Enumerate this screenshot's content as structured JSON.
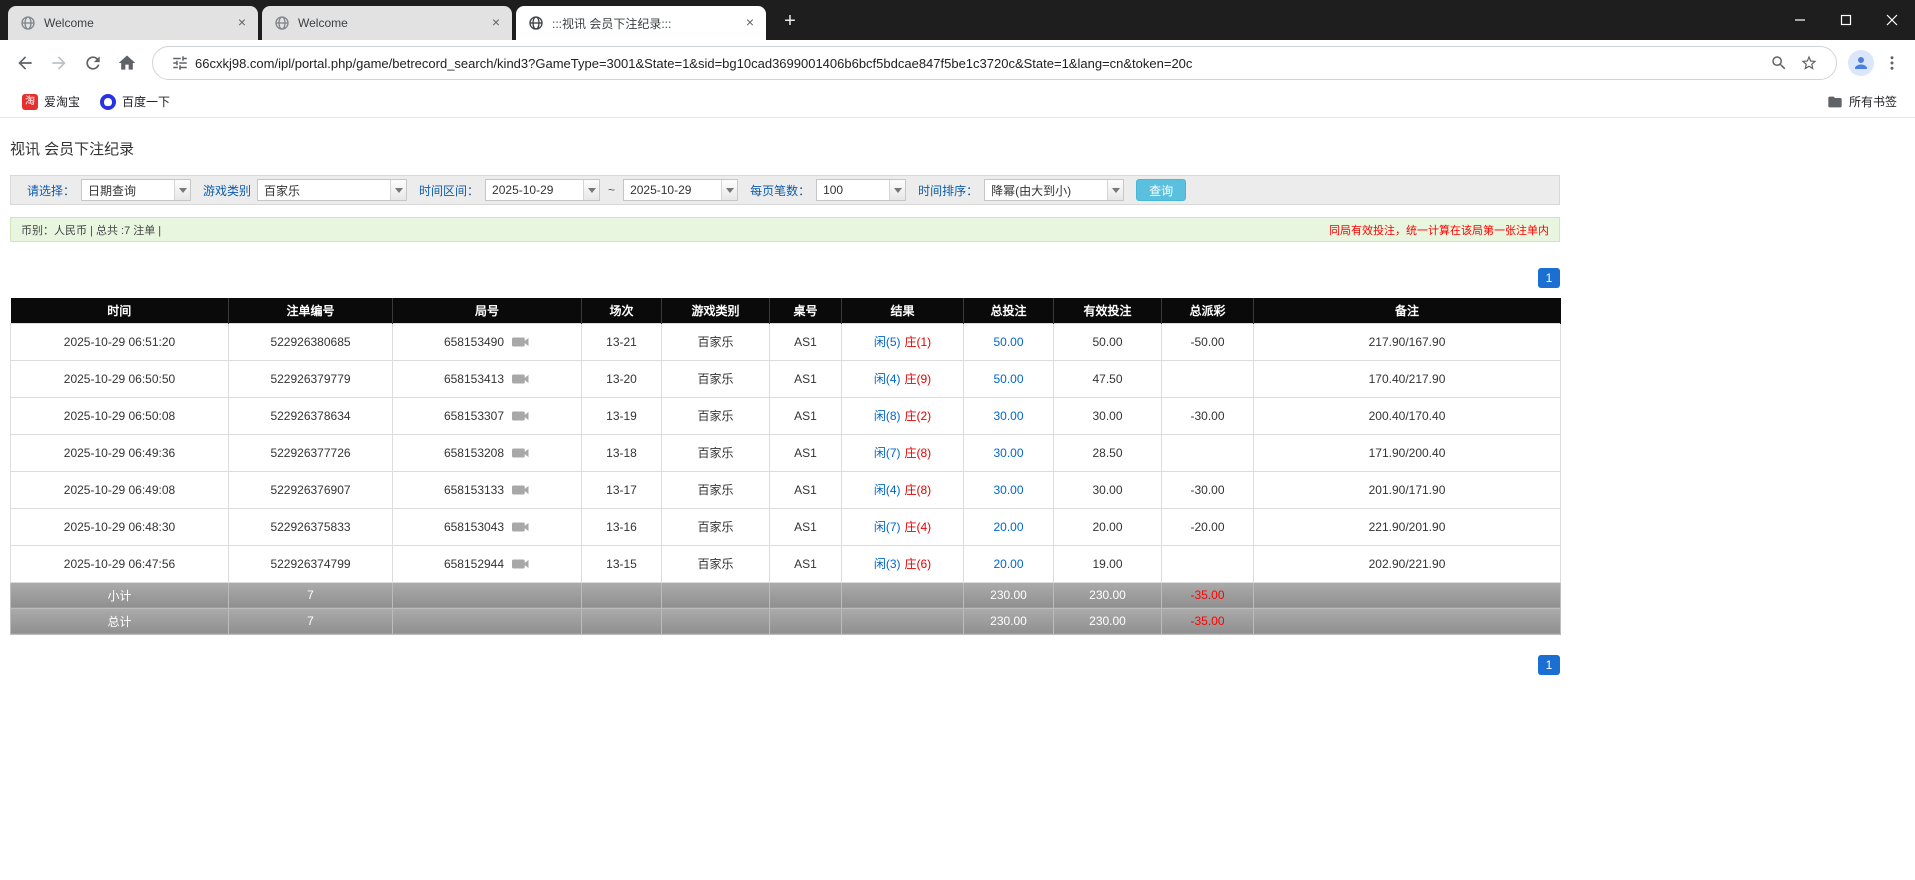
{
  "colors": {
    "link_blue": "#0066cc",
    "negative_red": "#e60000",
    "pager_blue": "#1b6fd2",
    "search_button_bg": "#5bc0de",
    "info_bar_green": "#e8f6df",
    "header_black": "#0a0a0a"
  },
  "browser": {
    "tabs": [
      {
        "title": "Welcome",
        "active": false
      },
      {
        "title": "Welcome",
        "active": false
      },
      {
        "title": ":::视讯 会员下注纪录:::",
        "active": true
      }
    ],
    "url": "66cxkj98.com/ipl/portal.php/game/betrecord_search/kind3?GameType=3001&State=1&sid=bg10cad3699001406b6bcf5bdcae847f5be1c3720c&State=1&lang=cn&token=20c",
    "bookmarks": [
      {
        "label": "爱淘宝"
      },
      {
        "label": "百度一下"
      }
    ],
    "all_bookmarks_label": "所有书签"
  },
  "page": {
    "title": "视讯 会员下注纪录",
    "filters": {
      "select_label": "请选择：",
      "select_value": "日期查询",
      "game_label": "游戏类别",
      "game_value": "百家乐",
      "range_label": "时间区间：",
      "date_from": "2025-10-29",
      "date_to": "2025-10-29",
      "separator": "~",
      "per_page_label": "每页笔数：",
      "per_page_value": "100",
      "sort_label": "时间排序：",
      "sort_value": "降幂(由大到小)",
      "search_button": "查询"
    },
    "info_bar": {
      "left": "币别：人民币 | 总共 :7 注单 |",
      "right": "同局有效投注，统一计算在该局第一张注单内"
    },
    "pagination": {
      "page": "1"
    }
  },
  "table": {
    "headers": [
      "时间",
      "注单编号",
      "局号",
      "场次",
      "游戏类别",
      "桌号",
      "结果",
      "总投注",
      "有效投注",
      "总派彩",
      "备注"
    ],
    "rows": [
      {
        "time": "2025-10-29 06:51:20",
        "bet_id": "522926380685",
        "round": "658153490",
        "session": "13-21",
        "game": "百家乐",
        "table_no": "AS1",
        "player": "闲(5)",
        "banker": "庄(1)",
        "total": "50.00",
        "valid": "50.00",
        "payout": "-50.00",
        "note": "217.90/167.90"
      },
      {
        "time": "2025-10-29 06:50:50",
        "bet_id": "522926379779",
        "round": "658153413",
        "session": "13-20",
        "game": "百家乐",
        "table_no": "AS1",
        "player": "闲(4)",
        "banker": "庄(9)",
        "total": "50.00",
        "valid": "47.50",
        "payout": "",
        "note": "170.40/217.90"
      },
      {
        "time": "2025-10-29 06:50:08",
        "bet_id": "522926378634",
        "round": "658153307",
        "session": "13-19",
        "game": "百家乐",
        "table_no": "AS1",
        "player": "闲(8)",
        "banker": "庄(2)",
        "total": "30.00",
        "valid": "30.00",
        "payout": "-30.00",
        "note": "200.40/170.40"
      },
      {
        "time": "2025-10-29 06:49:36",
        "bet_id": "522926377726",
        "round": "658153208",
        "session": "13-18",
        "game": "百家乐",
        "table_no": "AS1",
        "player": "闲(7)",
        "banker": "庄(8)",
        "total": "30.00",
        "valid": "28.50",
        "payout": "",
        "note": "171.90/200.40"
      },
      {
        "time": "2025-10-29 06:49:08",
        "bet_id": "522926376907",
        "round": "658153133",
        "session": "13-17",
        "game": "百家乐",
        "table_no": "AS1",
        "player": "闲(4)",
        "banker": "庄(8)",
        "total": "30.00",
        "valid": "30.00",
        "payout": "-30.00",
        "note": "201.90/171.90"
      },
      {
        "time": "2025-10-29 06:48:30",
        "bet_id": "522926375833",
        "round": "658153043",
        "session": "13-16",
        "game": "百家乐",
        "table_no": "AS1",
        "player": "闲(7)",
        "banker": "庄(4)",
        "total": "20.00",
        "valid": "20.00",
        "payout": "-20.00",
        "note": "221.90/201.90"
      },
      {
        "time": "2025-10-29 06:47:56",
        "bet_id": "522926374799",
        "round": "658152944",
        "session": "13-15",
        "game": "百家乐",
        "table_no": "AS1",
        "player": "闲(3)",
        "banker": "庄(6)",
        "total": "20.00",
        "valid": "19.00",
        "payout": "",
        "note": "202.90/221.90"
      }
    ],
    "subtotal": {
      "label": "小计",
      "count": "7",
      "total": "230.00",
      "valid": "230.00",
      "payout": "-35.00"
    },
    "grand_total": {
      "label": "总计",
      "count": "7",
      "total": "230.00",
      "valid": "230.00",
      "payout": "-35.00"
    }
  }
}
